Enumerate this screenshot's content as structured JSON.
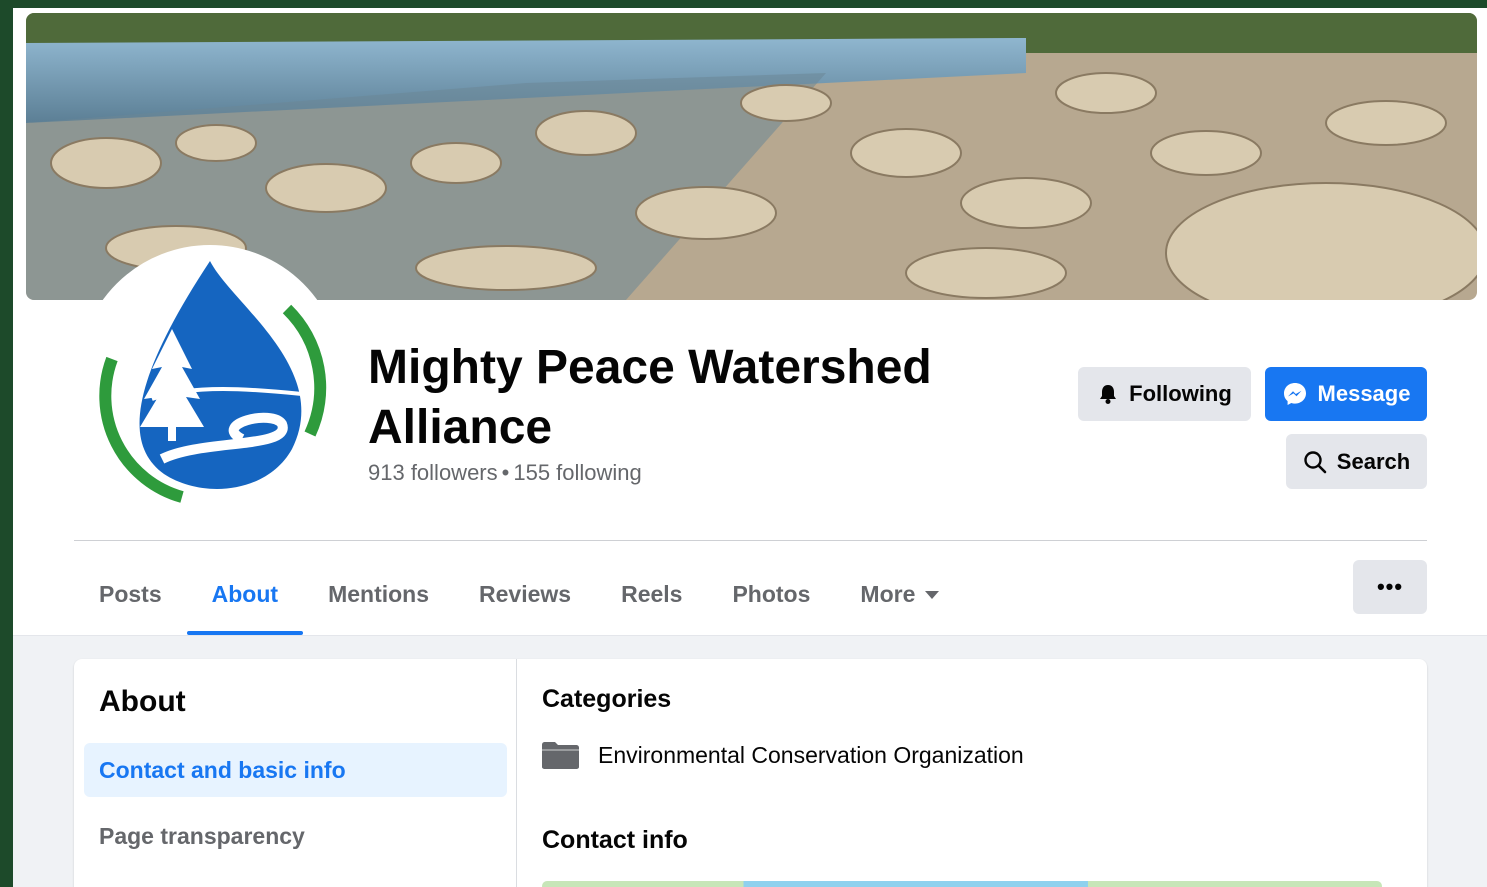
{
  "page": {
    "name": "Mighty Peace Watershed Alliance",
    "followers": "913 followers",
    "following": "155 following",
    "separator": "•"
  },
  "actions": {
    "following_label": "Following",
    "message_label": "Message",
    "search_label": "Search",
    "more_options_label": "•••"
  },
  "tabs": [
    {
      "label": "Posts",
      "active": false
    },
    {
      "label": "About",
      "active": true
    },
    {
      "label": "Mentions",
      "active": false
    },
    {
      "label": "Reviews",
      "active": false
    },
    {
      "label": "Reels",
      "active": false
    },
    {
      "label": "Photos",
      "active": false
    },
    {
      "label": "More",
      "active": false
    }
  ],
  "about": {
    "title": "About",
    "menu": [
      {
        "label": "Contact and basic info",
        "active": true
      },
      {
        "label": "Page transparency",
        "active": false
      },
      {
        "label": "",
        "active": false
      }
    ]
  },
  "details": {
    "categories_title": "Categories",
    "category": "Environmental Conservation Organization",
    "contact_title": "Contact info"
  },
  "colors": {
    "accent": "#1877f2",
    "logo_blue": "#1565c0",
    "logo_green": "#2e9b3c",
    "frame_green": "#1d4a2a"
  },
  "icons": {
    "following": "bell-icon",
    "message": "messenger-icon",
    "search": "search-icon",
    "category": "folder-icon",
    "more": "caret-down-icon"
  }
}
